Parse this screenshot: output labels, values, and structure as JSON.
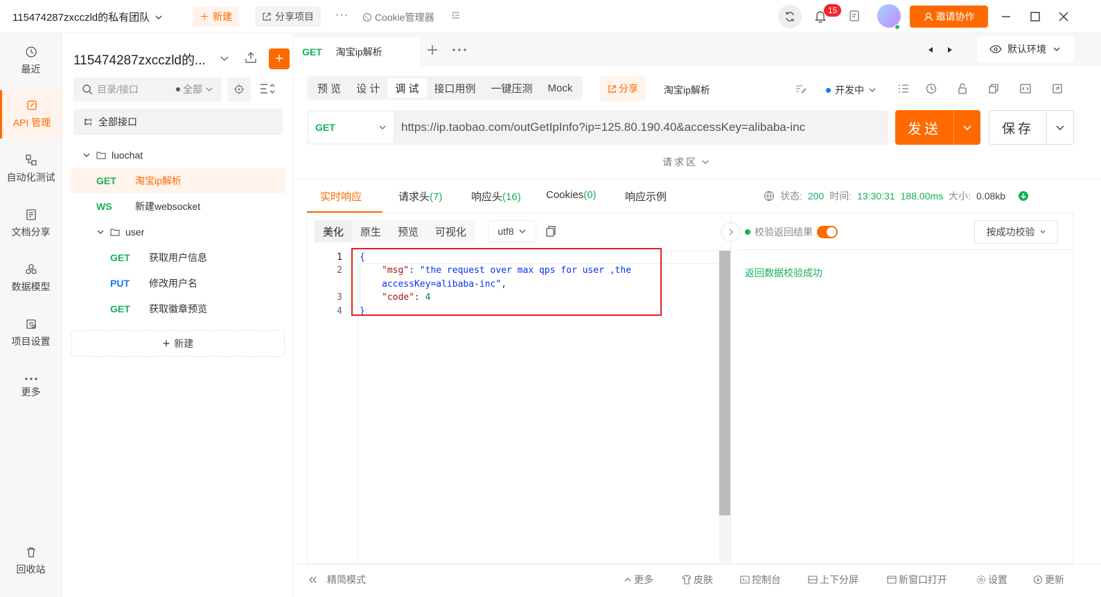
{
  "titlebar": {
    "team": "115474287zxcczld的私有团队",
    "new_label": "新建",
    "share_label": "分享项目",
    "dots": "···",
    "cookie_label": "Cookie管理器",
    "badge_count": "15",
    "invite_label": "邀请协作"
  },
  "leftnav": {
    "items": [
      {
        "label": "最近",
        "icon": "clock-icon"
      },
      {
        "label": "API 管理",
        "icon": "api-icon"
      },
      {
        "label": "自动化测试",
        "icon": "automation-icon"
      },
      {
        "label": "文档分享",
        "icon": "doc-share-icon"
      },
      {
        "label": "数据模型",
        "icon": "data-model-icon"
      },
      {
        "label": "项目设置",
        "icon": "project-settings-icon"
      },
      {
        "label": "更多",
        "icon": "more-icon"
      }
    ],
    "trash": "回收站"
  },
  "tree": {
    "project": "115474287zxcczld的...",
    "search_placeholder": "目录/接口",
    "filter_label": "全部",
    "all_api": "全部接口",
    "new_label": "新建",
    "rows": [
      {
        "type": "folder",
        "label": "luochat"
      },
      {
        "type": "api",
        "method": "GET",
        "label": "淘宝ip解析"
      },
      {
        "type": "api",
        "method": "WS",
        "label": "新建websocket"
      },
      {
        "type": "folder",
        "label": "user"
      },
      {
        "type": "api",
        "method": "GET",
        "label": "获取用户信息"
      },
      {
        "type": "api",
        "method": "PUT",
        "label": "修改用户名"
      },
      {
        "type": "api",
        "method": "GET",
        "label": "获取徽章预览"
      }
    ]
  },
  "tabbar": {
    "tab_method": "GET",
    "tab_title": "淘宝ip解析",
    "env_label": "默认环境"
  },
  "subtabs": [
    "预 览",
    "设 计",
    "调 试",
    "接口用例",
    "一键压测",
    "Mock"
  ],
  "active_subtab": "调 试",
  "share_label": "分享",
  "api_name": "淘宝ip解析",
  "status_label": "开发中",
  "request": {
    "method": "GET",
    "url": "https://ip.taobao.com/outGetIpInfo?ip=125.80.190.40&accessKey=alibaba-inc",
    "send_label": "发送",
    "save_label": "保存",
    "area_label": "请求区"
  },
  "response_tabs": {
    "realtime": "实时响应",
    "req_headers": "请求头",
    "req_headers_count": "(7)",
    "resp_headers": "响应头",
    "resp_headers_count": "(16)",
    "cookies": "Cookies",
    "cookies_count": "(0)",
    "example": "响应示例"
  },
  "response_meta": {
    "status_label": "状态:",
    "status": "200",
    "time_label": "时间:",
    "time": "13:30:31",
    "duration": "188.00ms",
    "size_label": "大小:",
    "size": "0.08kb"
  },
  "body_tabs": [
    "美化",
    "原生",
    "预览",
    "可视化"
  ],
  "encoding": "utf8",
  "code": {
    "line_numbers": [
      "1",
      "2",
      "",
      "3",
      "4"
    ],
    "open_brace": "{",
    "msg_key": "\"msg\"",
    "msg_val_1": "\"the request over max qps for user ,the",
    "msg_val_2": "accessKey=alibaba-inc\"",
    "code_key": "\"code\"",
    "code_val": "4",
    "close_brace": "}"
  },
  "verify": {
    "label": "校验返回结果",
    "mode": "按成功校验",
    "message": "返回数据校验成功"
  },
  "footer": {
    "simple_mode": "精简模式",
    "more": "更多",
    "skin": "皮肤",
    "console": "控制台",
    "split": "上下分屏",
    "new_window": "新窗口打开",
    "settings": "设置",
    "update": "更新"
  },
  "colors": {
    "accent": "#ff6a00",
    "get": "#13b05a",
    "put": "#1677ff",
    "highlight_box": "#e02020"
  }
}
